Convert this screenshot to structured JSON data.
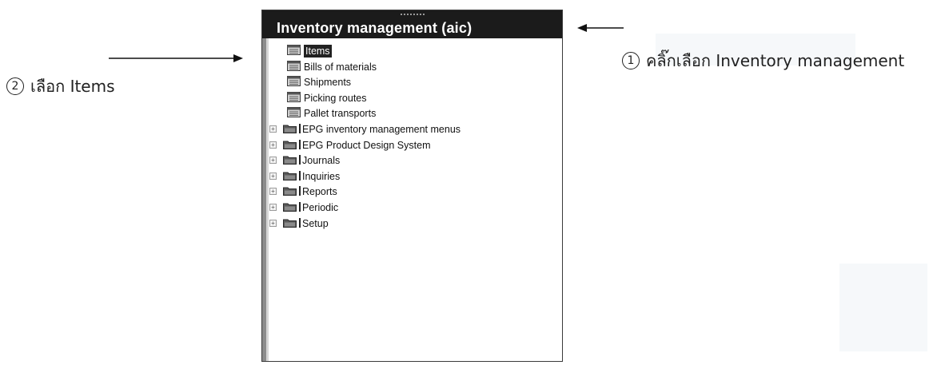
{
  "pane": {
    "title": "Inventory management (aic)",
    "items": [
      {
        "label": "Items",
        "type": "doc",
        "selected": true
      },
      {
        "label": "Bills of materials",
        "type": "doc",
        "selected": false
      },
      {
        "label": "Shipments",
        "type": "doc",
        "selected": false
      },
      {
        "label": "Picking routes",
        "type": "doc",
        "selected": false
      },
      {
        "label": "Pallet transports",
        "type": "doc",
        "selected": false
      },
      {
        "label": "EPG inventory management menus",
        "type": "folder",
        "selected": false
      },
      {
        "label": "EPG Product Design System",
        "type": "folder",
        "selected": false
      },
      {
        "label": "Journals",
        "type": "folder",
        "selected": false
      },
      {
        "label": "Inquiries",
        "type": "folder",
        "selected": false
      },
      {
        "label": "Reports",
        "type": "folder",
        "selected": false
      },
      {
        "label": "Periodic",
        "type": "folder",
        "selected": false
      },
      {
        "label": "Setup",
        "type": "folder",
        "selected": false
      }
    ]
  },
  "annotations": {
    "step1": {
      "number": "1",
      "text": "คลิ๊กเลือก Inventory management"
    },
    "step2": {
      "number": "2",
      "text": "เลือก Items"
    }
  },
  "colors": {
    "header_bg": "#1b1b1b",
    "folder": "#5a5a5a",
    "selected_bg": "#222222"
  }
}
